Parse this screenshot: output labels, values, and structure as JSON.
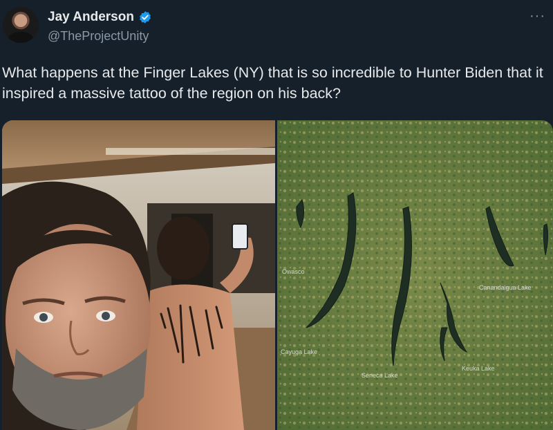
{
  "author": {
    "name": "Jay Anderson",
    "handle": "@TheProjectUnity",
    "verified_icon": "verified-badge-icon",
    "avatar_icon": "avatar"
  },
  "more_label": "···",
  "tweet_text": "What happens at the Finger Lakes (NY) that is so incredible to Hunter Biden that it inspired a massive tattoo of the region on his back?",
  "media": {
    "left_image": "photo-mirror-selfie",
    "right_image": "satellite-map-finger-lakes",
    "map_labels": [
      "Owasco",
      "Cayuga Lake",
      "Seneca Lake",
      "Keuka Lake",
      "Canandaigua Lake"
    ]
  },
  "colors": {
    "background": "#15202b",
    "text": "#e7e9ea",
    "secondary": "#8b98a5",
    "verified": "#1d9bf0"
  }
}
